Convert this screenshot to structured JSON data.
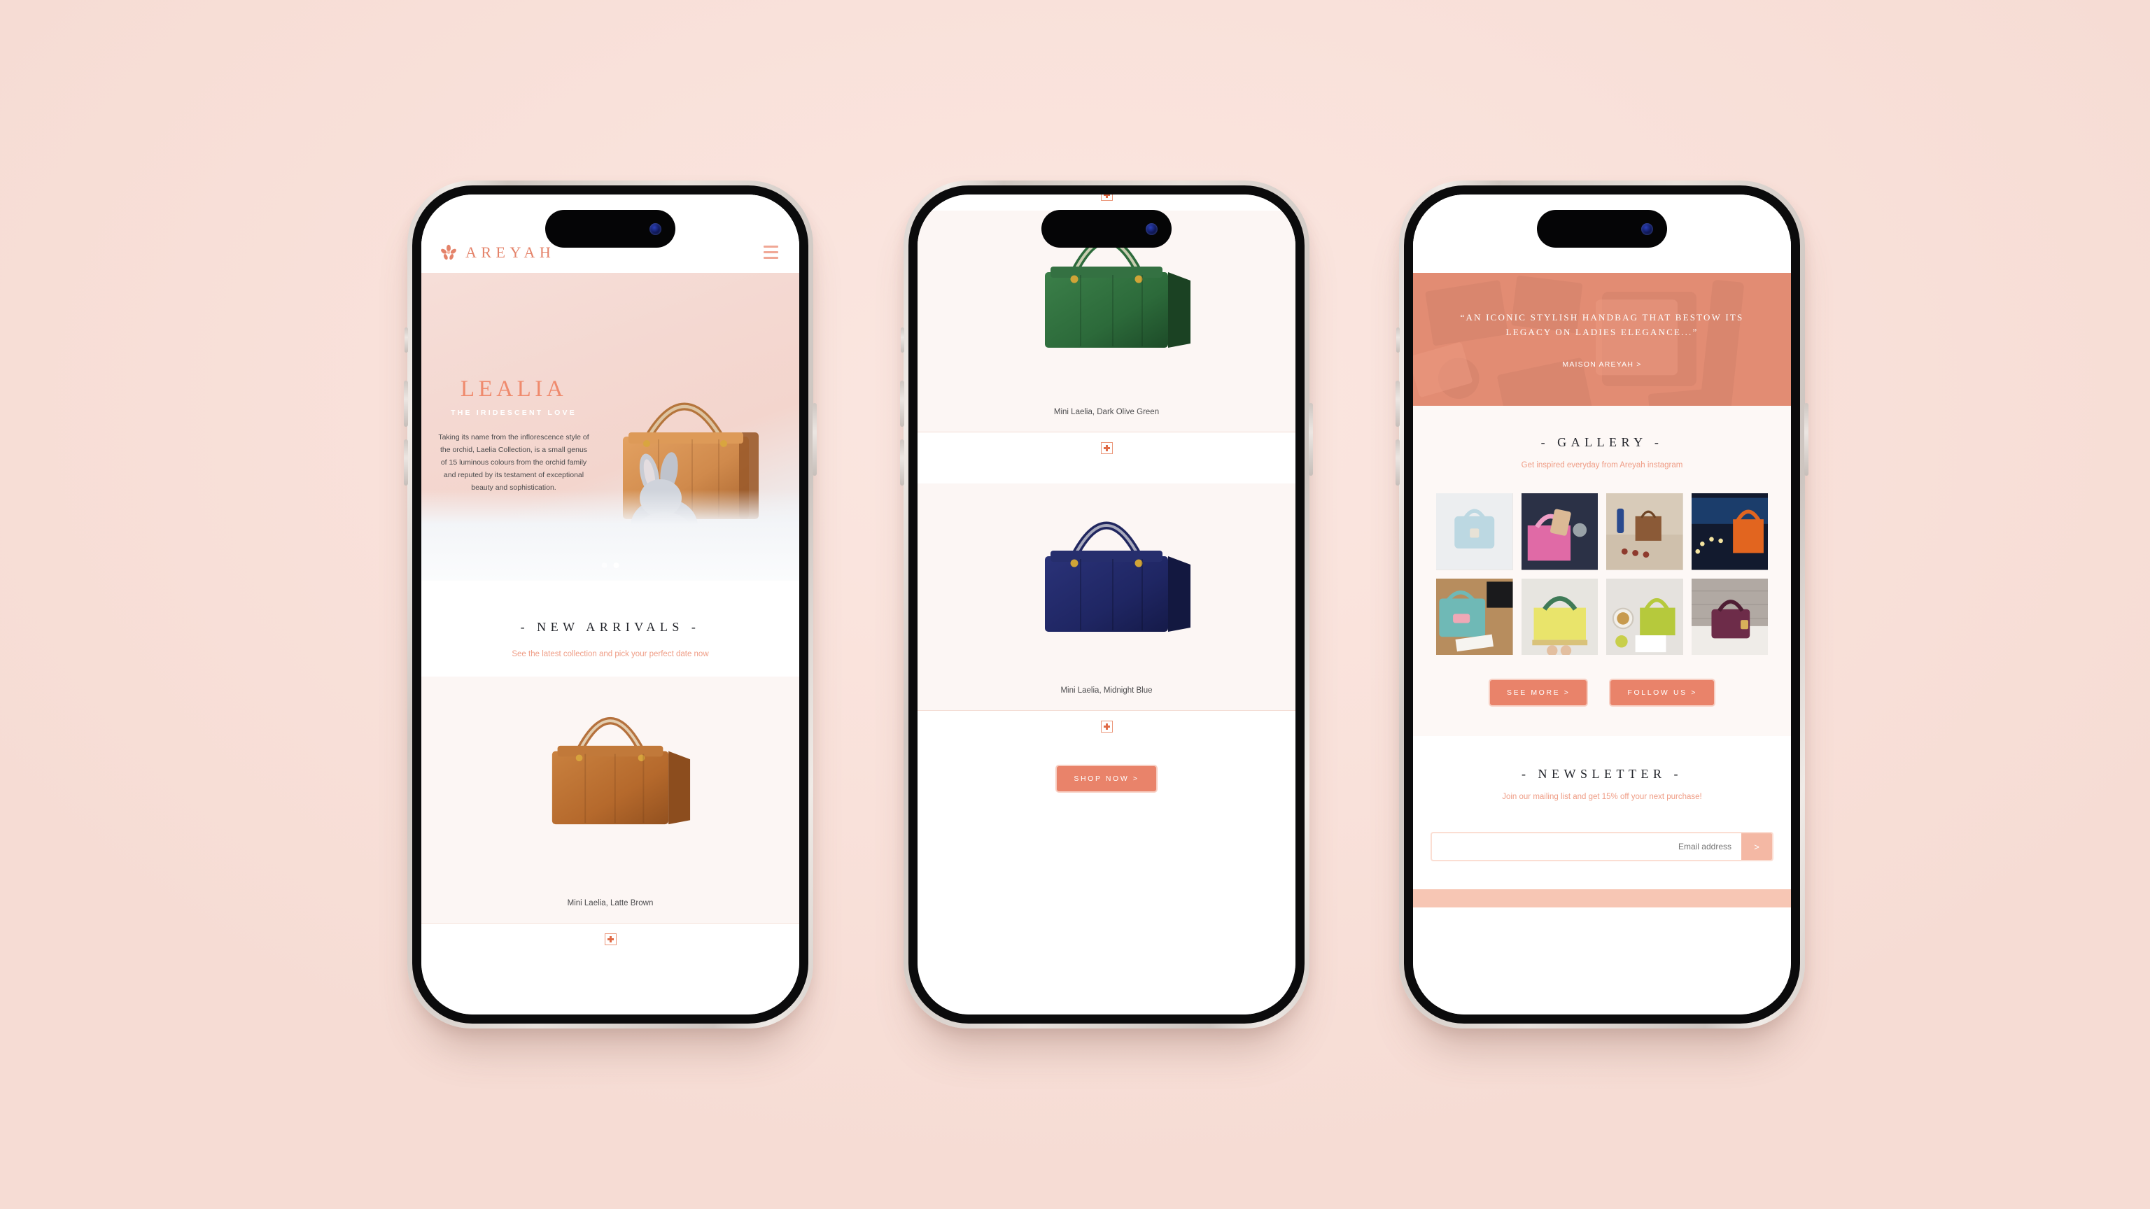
{
  "page": {
    "background_color": "#f8e0d9",
    "accent_color": "#e9836a",
    "accent_soft": "#f0a795",
    "device_count": 3
  },
  "brand": {
    "name": "AREYAH",
    "logo_icon": "orchid-flower-icon",
    "menu_icon": "hamburger-menu-icon"
  },
  "phone1": {
    "hero": {
      "title": "LEALIA",
      "subtitle": "THE IRIDESCENT LOVE",
      "body": "Taking its name from the inflorescence style of the orchid, Laelia Collection, is a small genus of 15 luminous colours from the orchid family and reputed by its testament of exceptional beauty and sophistication.",
      "image_alt": "tan-lizard-handbag-with-grey-bunny-on-white-fur",
      "carousel_dots": 2,
      "carousel_active": 2
    },
    "new_arrivals": {
      "title": "- NEW ARRIVALS -",
      "subtitle": "See the latest collection and pick your perfect date now",
      "products": [
        {
          "name": "Mini Laelia, Latte Brown",
          "color": "#b5713d",
          "expand_icon": "plus-icon"
        }
      ]
    }
  },
  "phone2": {
    "products": [
      {
        "name": "Mini Laelia, Dark Olive Green",
        "color": "#2d6b3c",
        "expand_icon": "plus-icon"
      },
      {
        "name": "Mini Laelia, Midnight Blue",
        "color": "#20265f",
        "expand_icon": "plus-icon"
      }
    ],
    "shop_now_label": "SHOP NOW >"
  },
  "phone3": {
    "quote": {
      "text": "“AN ICONIC STYLISH HANDBAG THAT BESTOW ITS LEGACY ON LADIES ELEGANCE...”",
      "link_label": "MAISON AREYAH >",
      "band_color": "#ef9c85"
    },
    "gallery": {
      "title": "- GALLERY -",
      "subtitle": "Get inspired everyday from Areyah instagram",
      "items": [
        {
          "alt": "light-blue-mini-bag-on-white-fur",
          "c1": "#bcd8e2",
          "c2": "#eceef0"
        },
        {
          "alt": "pink-bag-held-with-phone-and-watch",
          "c1": "#e06aa6",
          "c2": "#2b3146"
        },
        {
          "alt": "brown-bag-on-table-with-canapes-and-blue-bottle",
          "c1": "#8b5a37",
          "c2": "#d8cbb9"
        },
        {
          "alt": "orange-bag-at-night-city-window-display",
          "c1": "#e2651f",
          "c2": "#121a2e"
        },
        {
          "alt": "teal-bag-open-with-pink-wallet-on-wood",
          "c1": "#6fb9b6",
          "c2": "#b78d5e"
        },
        {
          "alt": "yellow-bag-measured-with-ruler",
          "c1": "#e9e46b",
          "c2": "#3f7a57"
        },
        {
          "alt": "lime-bag-with-coffee-and-laelia-card",
          "c1": "#b6c93c",
          "c2": "#e5e2de"
        },
        {
          "alt": "purple-python-bag-on-marble-brick-wall",
          "c1": "#6d2c49",
          "c2": "#bdb6b0"
        }
      ],
      "buttons": [
        {
          "label": "SEE MORE >",
          "name": "see-more-button"
        },
        {
          "label": "FOLLOW US >",
          "name": "follow-us-button"
        }
      ]
    },
    "newsletter": {
      "title": "- NEWSLETTER -",
      "subtitle": "Join our mailing list and get 15% off your next purchase!",
      "placeholder": "Email address",
      "value": "",
      "submit_icon": ">"
    }
  }
}
